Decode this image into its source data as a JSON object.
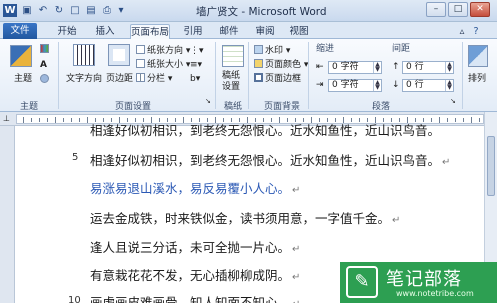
{
  "window": {
    "title": "墙广贤文 - Microsoft Word",
    "min": "–",
    "max": "□",
    "close": "✕"
  },
  "tabs": [
    "文件",
    "开始",
    "插入",
    "页面布局",
    "引用",
    "邮件",
    "审阅",
    "视图"
  ],
  "ribbon": {
    "theme": {
      "label": "主题",
      "group": "主题"
    },
    "page_setup": {
      "group": "页面设置",
      "text_direction": "文字方向",
      "margins": "页边距",
      "orientation": "纸张方向",
      "size": "纸张大小",
      "columns": "分栏"
    },
    "draft": {
      "label": "稿纸设置",
      "group": "稿纸"
    },
    "background": {
      "group": "页面背景",
      "watermark": "水印",
      "page_color": "页面颜色",
      "page_border": "页面边框"
    },
    "paragraph": {
      "group": "段落",
      "indent": "缩进",
      "spacing": "间距",
      "indent_left": "0 字符",
      "indent_right": "0 字符",
      "space_before": "0 行",
      "space_after": "0 行"
    },
    "arrange": {
      "label": "排列"
    }
  },
  "document": {
    "lines": [
      {
        "num": "",
        "text": "相逢好似初相识，到老终无怨恨心。近水知鱼性，近山识鸟音。"
      },
      {
        "num": "5",
        "text": "相逢好似初相识，到老终无怨恨心。近水知鱼性，近山识鸟音。"
      },
      {
        "num": "",
        "text": "易涨易退山溪水，易反易覆小人心。"
      },
      {
        "num": "",
        "text": "运去金成铁，时来铁似金，读书须用意，一字值千金。"
      },
      {
        "num": "",
        "text": "逢人且说三分话，未可全抛一片心。"
      },
      {
        "num": "",
        "text": "有意栽花花不发，无心插柳柳成阴。"
      },
      {
        "num": "10",
        "text": "画虎画皮难画骨，知人知面不知心。"
      }
    ],
    "para_mark": "↵"
  },
  "watermark": {
    "name": "笔记部落",
    "url": "www.notetribe.com"
  }
}
